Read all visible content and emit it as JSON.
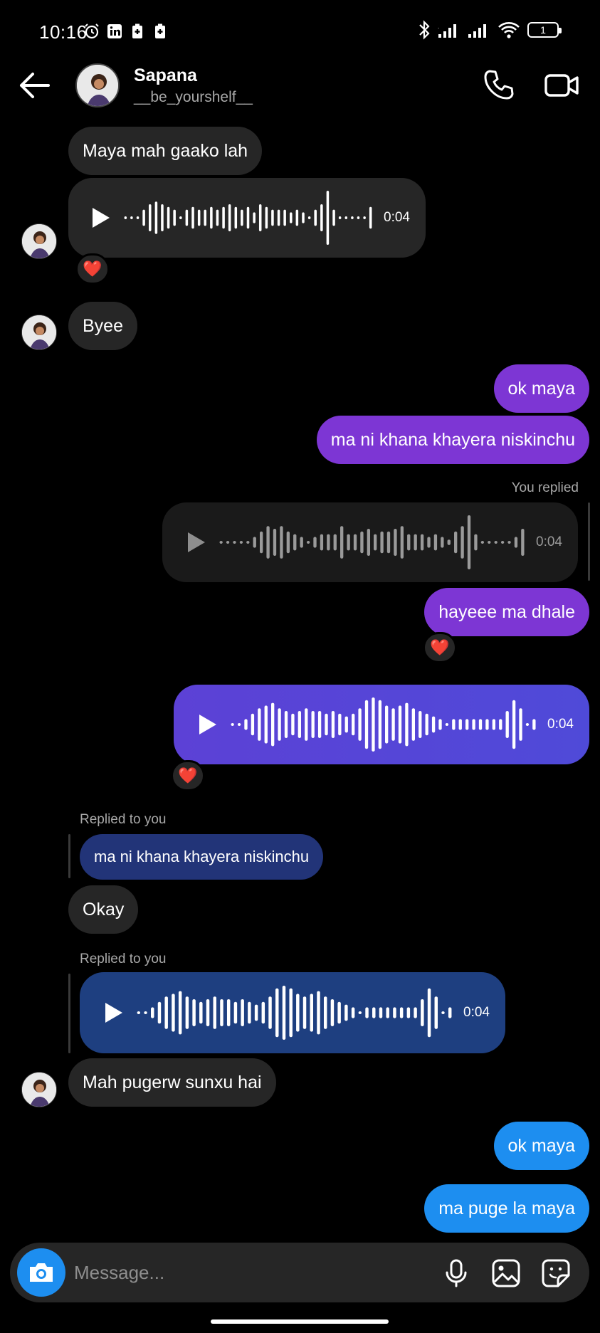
{
  "status_bar": {
    "time": "10:16",
    "battery": "1"
  },
  "header": {
    "name": "Sapana",
    "username": "__be_yourshelf__"
  },
  "messages": [
    {
      "kind": "text",
      "side": "in",
      "text": "Maya mah gaako lah"
    },
    {
      "kind": "voice",
      "side": "in",
      "duration": "0:04",
      "reaction": "❤️"
    },
    {
      "kind": "text",
      "side": "in",
      "text": "Byee"
    },
    {
      "kind": "text",
      "side": "out",
      "text": "ok maya"
    },
    {
      "kind": "text",
      "side": "out",
      "text": "ma ni khana khayera niskinchu"
    },
    {
      "kind": "meta",
      "text": "You replied"
    },
    {
      "kind": "voice",
      "side": "quoted",
      "duration": "0:04"
    },
    {
      "kind": "text",
      "side": "out",
      "text": "hayeee ma dhale",
      "reaction": "❤️"
    },
    {
      "kind": "voice",
      "side": "out",
      "duration": "0:04",
      "reaction": "❤️"
    },
    {
      "kind": "meta",
      "text": "Replied to you"
    },
    {
      "kind": "quote",
      "text": "ma ni khana khayera niskinchu"
    },
    {
      "kind": "text",
      "side": "in",
      "text": "Okay"
    },
    {
      "kind": "meta",
      "text": "Replied to you"
    },
    {
      "kind": "voice",
      "side": "quote",
      "duration": "0:04"
    },
    {
      "kind": "text",
      "side": "in",
      "text": "Mah pugerw sunxu hai"
    },
    {
      "kind": "text",
      "side": "out",
      "text": "ok maya"
    },
    {
      "kind": "text",
      "side": "out",
      "text": "ma puge la maya"
    }
  ],
  "composer": {
    "placeholder": "Message..."
  },
  "colors": {
    "incoming": "#262626",
    "purple": "#7d36d4",
    "indigo": "#5246d8",
    "blue": "#1d8ef0",
    "quote": "#223478",
    "quote_voice": "#1e3f80"
  }
}
